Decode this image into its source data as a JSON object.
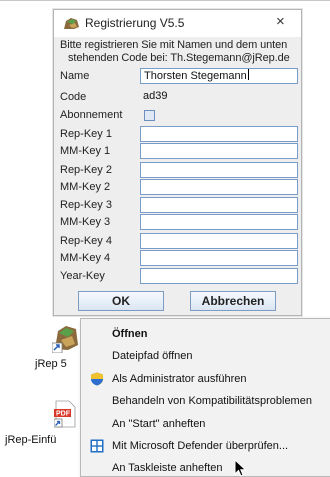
{
  "dialog": {
    "title": "Registrierung V5.5",
    "close_label": "×",
    "info_line1": "Bitte registrieren Sie mit Namen und dem unten",
    "info_line2": "stehenden Code bei: Th.Stegemann@jRep.de",
    "name_label": "Name",
    "name_value": "Thorsten Stegemann",
    "code_label": "Code",
    "code_value": "ad39",
    "abo_label": "Abonnement",
    "abo_checked": false,
    "keys": [
      {
        "label": "Rep-Key 1",
        "value": ""
      },
      {
        "label": "MM-Key 1",
        "value": ""
      },
      {
        "label": "Rep-Key 2",
        "value": ""
      },
      {
        "label": "MM-Key 2",
        "value": ""
      },
      {
        "label": "Rep-Key 3",
        "value": ""
      },
      {
        "label": "MM-Key 3",
        "value": ""
      },
      {
        "label": "Rep-Key 4",
        "value": ""
      },
      {
        "label": "MM-Key 4",
        "value": ""
      },
      {
        "label": "Year-Key",
        "value": ""
      }
    ],
    "ok_label": "OK",
    "cancel_label": "Abbrechen"
  },
  "desktop": {
    "icon1_label": "jRep 5",
    "icon2_label": "jRep-Einfü"
  },
  "context_menu": {
    "items": [
      {
        "label": "Öffnen",
        "icon": ""
      },
      {
        "label": "Dateipfad öffnen",
        "icon": ""
      },
      {
        "label": "Als Administrator ausführen",
        "icon": "shield-icon"
      },
      {
        "label": "Behandeln von Kompatibilitätsproblemen",
        "icon": ""
      },
      {
        "label": "An \"Start\" anheften",
        "icon": ""
      },
      {
        "label": "Mit Microsoft Defender überprüfen...",
        "icon": "defender-icon"
      },
      {
        "label": "An Taskleiste anheften",
        "icon": ""
      }
    ]
  },
  "colors": {
    "dialog_bg": "#eeeeee",
    "field_border": "#7a9cc8",
    "menu_bg": "#f2f2f2",
    "defender_blue": "#1f6fc5"
  }
}
